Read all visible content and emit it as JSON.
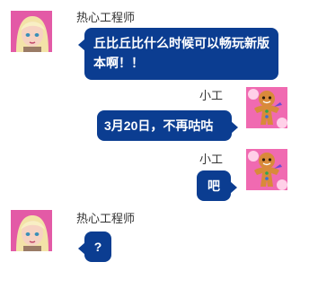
{
  "colors": {
    "bubble": "#0b3d91",
    "bubble_text": "#ffffff",
    "name_text": "#333333"
  },
  "messages": [
    {
      "sender": "热心工程师",
      "side": "left",
      "avatar": "girl-avatar-icon",
      "text": "丘比丘比什么时候可以畅玩新版本啊！！"
    },
    {
      "sender": "小工",
      "side": "right",
      "avatar": "gingerbread-avatar-icon",
      "text": "3月20日，不再咕咕"
    },
    {
      "sender": "小工",
      "side": "right",
      "avatar": "gingerbread-avatar-icon",
      "text": "吧"
    },
    {
      "sender": "热心工程师",
      "side": "left",
      "avatar": "girl-avatar-icon",
      "text": "?"
    }
  ]
}
